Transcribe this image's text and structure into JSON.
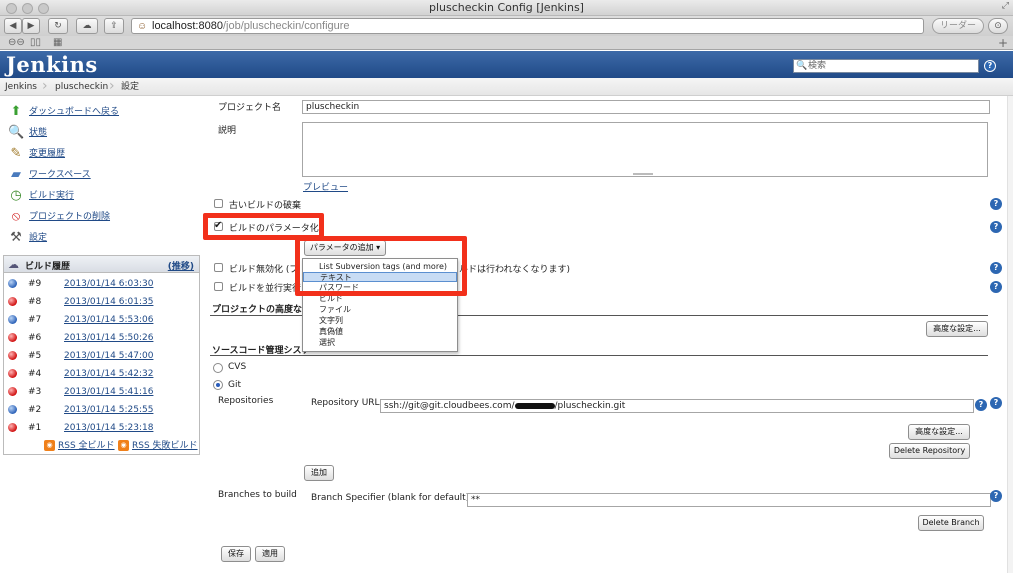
{
  "window": {
    "title": "pluscheckin Config [Jenkins]",
    "url_host": "localhost:8080",
    "url_path": "/job/pluscheckin/configure",
    "reader_label": "リーダー"
  },
  "header": {
    "logo": "Jenkins",
    "search_placeholder": "検索",
    "help": "?"
  },
  "breadcrumb": [
    "Jenkins",
    "pluscheckin",
    "設定"
  ],
  "sidebar": {
    "items": [
      {
        "label": "ダッシュボードへ戻る",
        "icon": "up-arrow-icon"
      },
      {
        "label": "状態",
        "icon": "magnifier-icon"
      },
      {
        "label": "変更履歴",
        "icon": "notepad-icon"
      },
      {
        "label": "ワークスペース",
        "icon": "folder-icon"
      },
      {
        "label": "ビルド実行",
        "icon": "clock-icon"
      },
      {
        "label": "プロジェクトの削除",
        "icon": "no-entry-icon"
      },
      {
        "label": "設定",
        "icon": "wrench-icon"
      }
    ],
    "history_title": "ビルド履歴",
    "history_trend": "(推移)",
    "builds": [
      {
        "num": "#9",
        "date": "2013/01/14 6:03:30",
        "status": "blue"
      },
      {
        "num": "#8",
        "date": "2013/01/14 6:01:35",
        "status": "red"
      },
      {
        "num": "#7",
        "date": "2013/01/14 5:53:06",
        "status": "blue"
      },
      {
        "num": "#6",
        "date": "2013/01/14 5:50:26",
        "status": "red"
      },
      {
        "num": "#5",
        "date": "2013/01/14 5:47:00",
        "status": "red"
      },
      {
        "num": "#4",
        "date": "2013/01/14 5:42:32",
        "status": "red"
      },
      {
        "num": "#3",
        "date": "2013/01/14 5:41:16",
        "status": "red"
      },
      {
        "num": "#2",
        "date": "2013/01/14 5:25:55",
        "status": "blue"
      },
      {
        "num": "#1",
        "date": "2013/01/14 5:23:18",
        "status": "red"
      }
    ],
    "rss_all": "RSS 全ビルド",
    "rss_failed": "RSS 失敗ビルド"
  },
  "form": {
    "project_name_label": "プロジェクト名",
    "project_name_value": "pluscheckin",
    "description_label": "説明",
    "preview_link": "プレビュー",
    "discard_old_builds": "古いビルドの破棄",
    "parameterized": "ビルドのパラメータ化",
    "add_parameter_button": "パラメータの追加 ▾",
    "disable_build_prefix": "ビルド無効化 (プ",
    "disable_build_suffix": "ルドは行われなくなります)",
    "concurrent_build": "ビルドを並行実行",
    "advanced_project_options": "プロジェクトの高度なオ",
    "advanced_button": "高度な設定...",
    "scm_section": "ソースコード管理システ",
    "scm_cvs": "CVS",
    "scm_git": "Git",
    "repositories_label": "Repositories",
    "repository_url_label": "Repository URL",
    "repository_url_prefix": "ssh://git@git.cloudbees.com/",
    "repository_url_suffix": "/pluscheckin.git",
    "repo_advanced_button": "高度な設定...",
    "delete_repository_button": "Delete Repository",
    "add_button": "追加",
    "branches_label": "Branches to build",
    "branch_specifier_label": "Branch Specifier (blank for default):",
    "branch_specifier_value": "**",
    "delete_branch_button": "Delete Branch",
    "save_button": "保存",
    "apply_button": "適用"
  },
  "parameter_menu": {
    "items": [
      "List Subversion tags (and more)",
      "テキスト",
      "パスワード",
      "ビルド",
      "ファイル",
      "文字列",
      "真偽値",
      "選択"
    ],
    "highlighted": "テキスト"
  },
  "colors": {
    "jenkins_header": "#204a87",
    "highlight_box": "#f2301b",
    "link": "#204a87"
  }
}
